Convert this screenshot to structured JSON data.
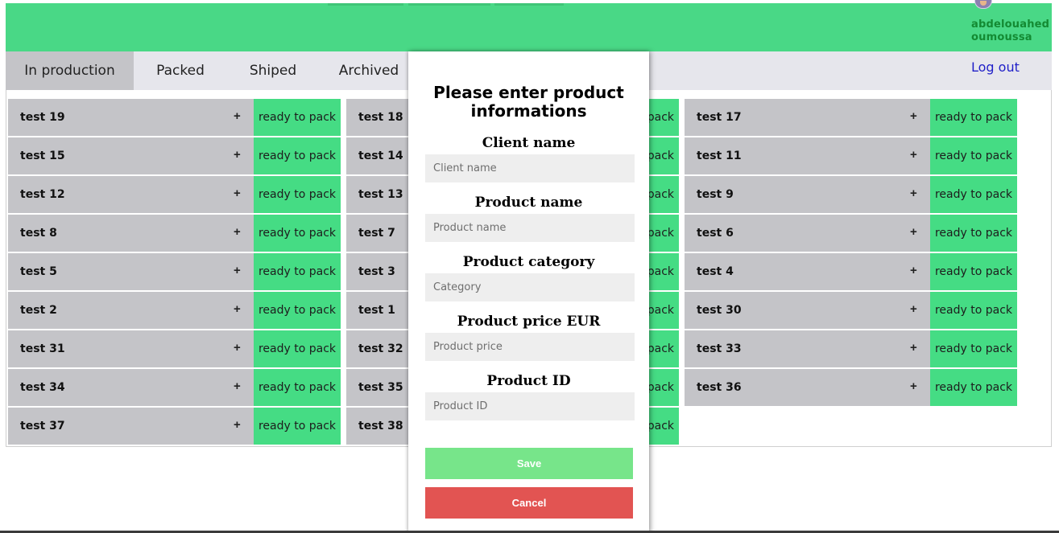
{
  "header": {
    "user_name": "abdelouahed oumoussa",
    "avatar_icon": "user-avatar-icon",
    "accent_color": "#49d886"
  },
  "nav": {
    "tabs": [
      {
        "label": "In production",
        "active": true
      },
      {
        "label": "Packed",
        "active": false
      },
      {
        "label": "Shiped",
        "active": false
      },
      {
        "label": "Archived",
        "active": false
      }
    ],
    "logout_label": "Log out"
  },
  "products": {
    "column1": [
      {
        "name": "test 19",
        "status": "ready to pack"
      },
      {
        "name": "test 15",
        "status": "ready to pack"
      },
      {
        "name": "test 12",
        "status": "ready to pack"
      },
      {
        "name": "test 8",
        "status": "ready to pack"
      },
      {
        "name": "test 5",
        "status": "ready to pack"
      },
      {
        "name": "test 2",
        "status": "ready to pack"
      },
      {
        "name": "test 31",
        "status": "ready to pack"
      },
      {
        "name": "test 34",
        "status": "ready to pack"
      },
      {
        "name": "test 37",
        "status": "ready to pack"
      }
    ],
    "column2": [
      {
        "name": "test 18",
        "status": "ready to pack"
      },
      {
        "name": "test 14",
        "status": "ready to pack"
      },
      {
        "name": "test 13",
        "status": "ready to pack"
      },
      {
        "name": "test 7",
        "status": "ready to pack"
      },
      {
        "name": "test 3",
        "status": "ready to pack"
      },
      {
        "name": "test 1",
        "status": "ready to pack"
      },
      {
        "name": "test 32",
        "status": "ready to pack"
      },
      {
        "name": "test 35",
        "status": "ready to pack"
      },
      {
        "name": "test 38",
        "status": "ready to pack"
      }
    ],
    "column3": [
      {
        "name": "test 17",
        "status": "ready to pack"
      },
      {
        "name": "test 11",
        "status": "ready to pack"
      },
      {
        "name": "test 9",
        "status": "ready to pack"
      },
      {
        "name": "test 6",
        "status": "ready to pack"
      },
      {
        "name": "test 4",
        "status": "ready to pack"
      },
      {
        "name": "test 30",
        "status": "ready to pack"
      },
      {
        "name": "test 33",
        "status": "ready to pack"
      },
      {
        "name": "test 36",
        "status": "ready to pack"
      }
    ],
    "expand_symbol": "+"
  },
  "modal": {
    "title": "Please enter product informations",
    "fields": [
      {
        "label": "Client name",
        "placeholder": "Client name",
        "value": ""
      },
      {
        "label": "Product name",
        "placeholder": "Product name",
        "value": ""
      },
      {
        "label": "Product category",
        "placeholder": "Category",
        "value": ""
      },
      {
        "label": "Product price EUR",
        "placeholder": "Product price",
        "value": ""
      },
      {
        "label": "Product ID",
        "placeholder": "Product ID",
        "value": ""
      }
    ],
    "save_label": "Save",
    "cancel_label": "Cancel",
    "save_color": "#77e58a",
    "cancel_color": "#e25452"
  }
}
